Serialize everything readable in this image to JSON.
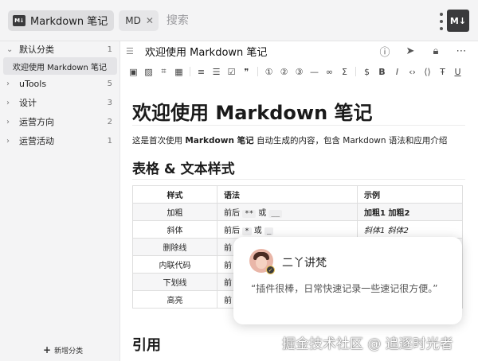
{
  "topbar": {
    "app_name": "Markdown 笔记",
    "mode_chip": "MD",
    "search_placeholder": "搜索",
    "plugin_icon_text": "M↓"
  },
  "sidebar": {
    "categories": [
      {
        "label": "默认分类",
        "count": "1",
        "expanded": true
      },
      {
        "label": "uTools",
        "count": "5",
        "expanded": false
      },
      {
        "label": "设计",
        "count": "3",
        "expanded": false
      },
      {
        "label": "运营方向",
        "count": "2",
        "expanded": false
      },
      {
        "label": "运营活动",
        "count": "1",
        "expanded": false
      }
    ],
    "active_note": "欢迎使用 Markdown 笔记",
    "add_category": "新增分类"
  },
  "editor": {
    "doc_title": "欢迎使用 Markdown 笔记",
    "header_icons": [
      "info-icon",
      "send-icon",
      "lock-icon",
      "more-horizontal-icon"
    ],
    "toolbar_icons": [
      "image-link-icon",
      "image-icon",
      "crop-icon",
      "table-icon",
      "ordered-list-icon",
      "bullet-list-icon",
      "checklist-icon",
      "quote-icon",
      "h1-icon",
      "h2-icon",
      "h3-icon",
      "hr-icon",
      "link-icon",
      "sigma-icon",
      "dollar-icon",
      "bold-icon",
      "italic-icon",
      "code-inline-icon",
      "code-block-icon",
      "strikethrough-icon",
      "underline-icon"
    ]
  },
  "content": {
    "h1": "欢迎使用 Markdown 笔记",
    "intro_pre": "这是首次使用 ",
    "intro_bold": "Markdown 笔记",
    "intro_post": " 自动生成的内容，包含 Markdown 语法和应用介绍",
    "h2": "表格 & 文本样式",
    "h2_next": "引用",
    "table": {
      "headers": [
        "样式",
        "语法",
        "示例"
      ],
      "rows": [
        {
          "style": "加粗",
          "syntax_pre": "前后 ",
          "code1": "**",
          "mid": " 或 ",
          "code2": "__",
          "example": "加粗1 加粗2"
        },
        {
          "style": "斜体",
          "syntax_pre": "前后 ",
          "code1": "*",
          "mid": " 或 ",
          "code2": "_",
          "example": "斜体1 斜体2"
        },
        {
          "style": "删除线",
          "syntax_pre": "前",
          "code1": "",
          "mid": "",
          "code2": "",
          "example": ""
        },
        {
          "style": "内联代码",
          "syntax_pre": "前",
          "code1": "",
          "mid": "",
          "code2": "",
          "example": ""
        },
        {
          "style": "下划线",
          "syntax_pre": "前",
          "code1": "",
          "mid": "",
          "code2": "",
          "example": ""
        },
        {
          "style": "高亮",
          "syntax_pre": "前",
          "code1": "",
          "mid": "",
          "code2": "",
          "example": ""
        }
      ]
    }
  },
  "card": {
    "name": "二丫讲梵",
    "quote": "“插件很棒，日常快速记录一些速记很方便。”"
  },
  "watermark": "掘金技术社区 @ 追逐时光者"
}
